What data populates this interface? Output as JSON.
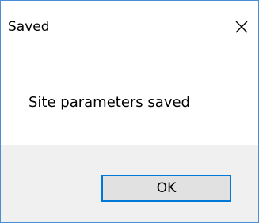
{
  "window": {
    "title": "Saved",
    "close_icon": "close-icon"
  },
  "message": {
    "text": "Site parameters saved"
  },
  "buttons": {
    "ok_label": "OK"
  },
  "colors": {
    "accent_border": "#0078d7",
    "window_border": "#4a8fd6",
    "footer_bg": "#f0f0f0",
    "button_bg": "#e1e1e1"
  }
}
